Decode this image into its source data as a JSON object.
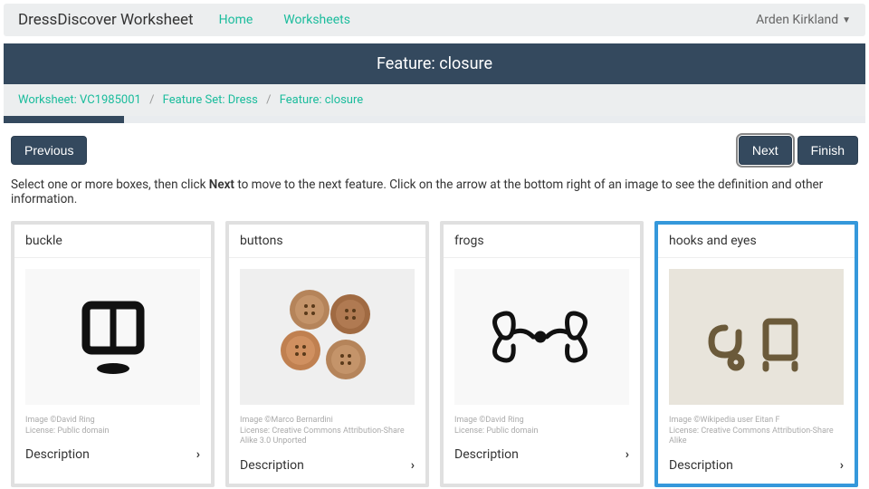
{
  "navbar": {
    "brand": "DressDiscover Worksheet",
    "links": [
      "Home",
      "Worksheets"
    ],
    "user": "Arden Kirkland"
  },
  "banner": {
    "title": "Feature: closure"
  },
  "breadcrumb": {
    "items": [
      "Worksheet: VC1985001",
      "Feature Set: Dress",
      "Feature: closure"
    ],
    "sep": "/"
  },
  "buttons": {
    "prev": "Previous",
    "next": "Next",
    "finish": "Finish"
  },
  "instructions": {
    "pre": "Select one or more boxes, then click ",
    "bold": "Next",
    "post": " to move to the next feature. Click on the arrow at the bottom right of an image to see the definition and other information."
  },
  "desc_label": "Description",
  "cards": [
    {
      "label": "buckle",
      "credit": "Image ©David Ring",
      "license": "License: Public domain",
      "selected": false
    },
    {
      "label": "buttons",
      "credit": "Image ©Marco Bernardini",
      "license": "License: Creative Commons Attribution-Share Alike 3.0 Unported",
      "selected": false
    },
    {
      "label": "frogs",
      "credit": "Image ©David Ring",
      "license": "License: Public domain",
      "selected": false
    },
    {
      "label": "hooks and eyes",
      "credit": "Image ©Wikipedia user Eitan F",
      "license": "License: Creative Commons Attribution-Share Alike",
      "selected": true
    }
  ]
}
